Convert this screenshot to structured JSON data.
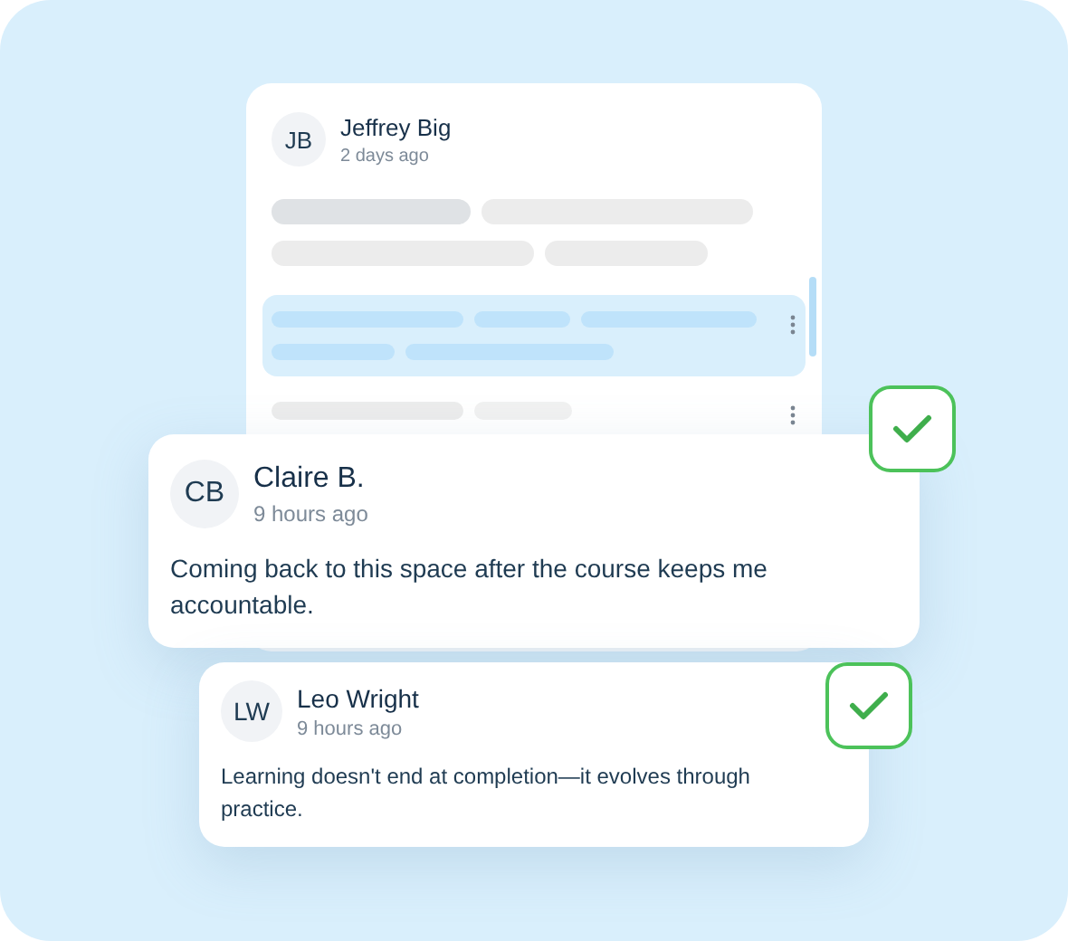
{
  "thread": {
    "initials": "JB",
    "name": "Jeffrey Big",
    "time": "2 days ago",
    "blocks": [
      {
        "selected": false
      },
      {
        "selected": true
      },
      {
        "selected": false
      }
    ]
  },
  "reviews": [
    {
      "initials": "CB",
      "name": "Claire B.",
      "time": "9 hours ago",
      "text": "Coming back to this space after the course keeps me accountable.",
      "checked": true
    },
    {
      "initials": "LW",
      "name": "Leo Wright",
      "time": "9 hours ago",
      "text": "Learning doesn't end at completion—it evolves through practice.",
      "checked": true
    }
  ]
}
